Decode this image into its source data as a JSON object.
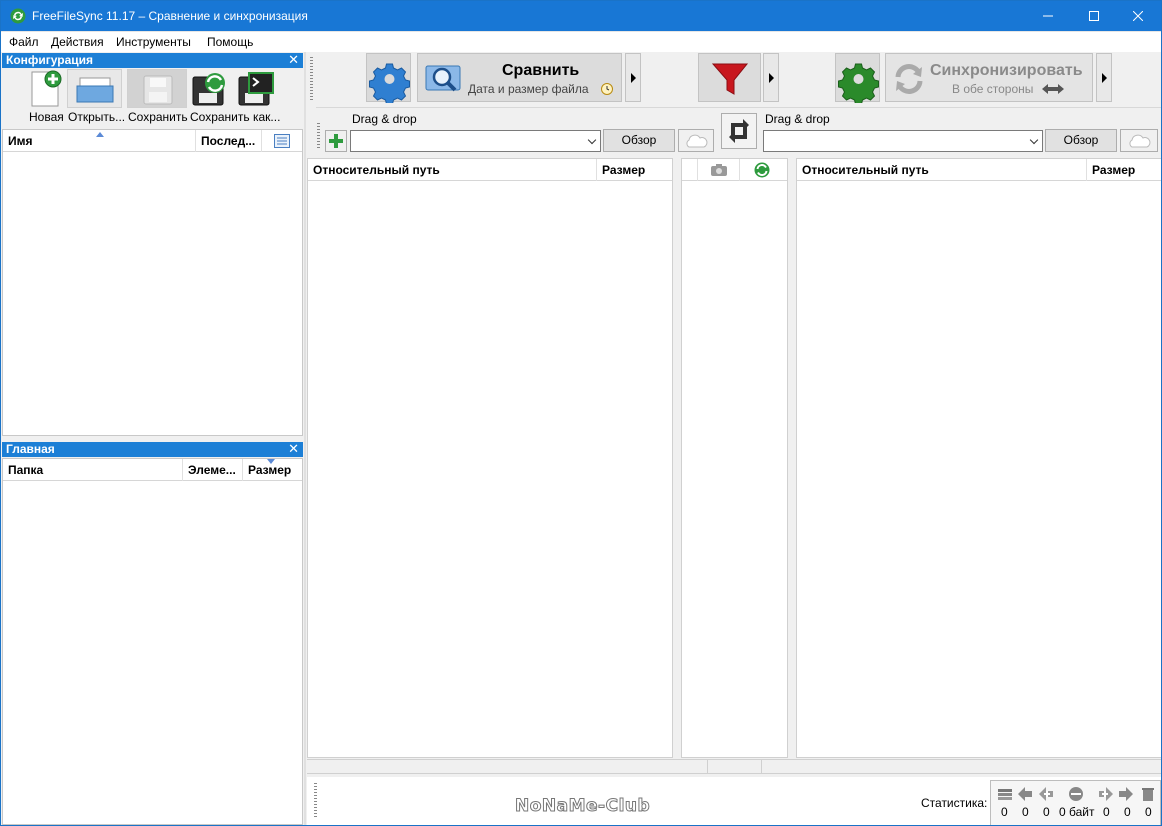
{
  "window": {
    "title": "FreeFileSync 11.17 – Сравнение и синхронизация"
  },
  "menu": [
    "Файл",
    "Действия",
    "Инструменты",
    "Помощь"
  ],
  "config_panel": {
    "title": "Конфигурация",
    "toolbar": [
      "Новая",
      "Открыть...",
      "Сохранить",
      "Сохранить как..."
    ],
    "columns": {
      "name": "Имя",
      "last": "Послед..."
    }
  },
  "main_panel": {
    "title": "Главная",
    "columns": {
      "folder": "Папка",
      "items": "Элеме...",
      "size": "Размер"
    }
  },
  "compare": {
    "label": "Сравнить",
    "sublabel": "Дата и размер файла"
  },
  "sync": {
    "label": "Синхронизировать",
    "sublabel": "В обе стороны"
  },
  "left_folder": {
    "drag_label": "Drag & drop",
    "value": "",
    "browse": "Обзор"
  },
  "right_folder": {
    "drag_label": "Drag & drop",
    "value": "",
    "browse": "Обзор"
  },
  "grid_left": {
    "path": "Относительный путь",
    "size": "Размер"
  },
  "grid_right": {
    "path": "Относительный путь",
    "size": "Размер"
  },
  "watermark": "NoNaMe-Club",
  "statistics": {
    "label": "Статистика:",
    "values": [
      "0",
      "0",
      "0",
      "0 байт",
      "0",
      "0",
      "0"
    ]
  },
  "colors": {
    "accent": "#1c7fd6",
    "titlebar": "#1877d5",
    "filter": "#c8171e",
    "gear": "#2a8a2a"
  }
}
